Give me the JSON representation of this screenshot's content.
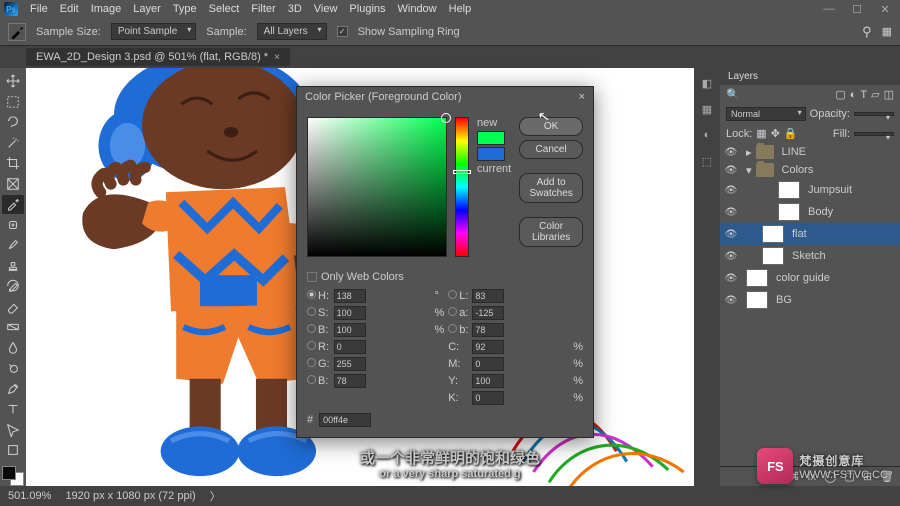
{
  "menu": [
    "File",
    "Edit",
    "Image",
    "Layer",
    "Type",
    "Select",
    "Filter",
    "3D",
    "View",
    "Plugins",
    "Window",
    "Help"
  ],
  "options": {
    "sample_size_label": "Sample Size:",
    "sample_size": "Point Sample",
    "sample_label": "Sample:",
    "sample": "All Layers",
    "show_ring": "Show Sampling Ring"
  },
  "tab": {
    "title": "EWA_2D_Design 3.psd @ 501% (flat, RGB/8) *"
  },
  "status": {
    "zoom": "501.09%",
    "doc": "1920 px x 1080 px (72 ppi)"
  },
  "layers_panel": {
    "title": "Layers",
    "blend": "Normal",
    "opacity_label": "Opacity:",
    "lock_label": "Lock:",
    "fill_label": "Fill:",
    "items": [
      {
        "type": "folder",
        "name": "LINE",
        "indent": 0
      },
      {
        "type": "folder",
        "name": "Colors",
        "indent": 0,
        "open": true
      },
      {
        "type": "layer",
        "name": "Jumpsuit",
        "indent": 2
      },
      {
        "type": "layer",
        "name": "Body",
        "indent": 2
      },
      {
        "type": "layer",
        "name": "flat",
        "indent": 1,
        "selected": true
      },
      {
        "type": "layer",
        "name": "Sketch",
        "indent": 1
      },
      {
        "type": "layer",
        "name": "color guide",
        "indent": 0
      },
      {
        "type": "layer",
        "name": "BG",
        "indent": 0
      }
    ]
  },
  "picker": {
    "title": "Color Picker (Foreground Color)",
    "ok": "OK",
    "cancel": "Cancel",
    "add": "Add to Swatches",
    "libs": "Color Libraries",
    "new": "new",
    "current": "current",
    "only_web": "Only Web Colors",
    "H": "138",
    "S": "100",
    "Bv": "100",
    "R": "0",
    "G": "255",
    "B": "78",
    "L": "83",
    "a": "-125",
    "b": "78",
    "C": "92",
    "M": "0",
    "Y": "100",
    "K": "0",
    "hex": "00ff4e"
  },
  "subtitle": {
    "cn": "或一个非常鲜明的饱和绿色",
    "en": "or a very sharp saturated g"
  },
  "watermark": {
    "badge": "FS",
    "line1": "梵摄创意库",
    "line2": "WWW.FSTVC.CC"
  }
}
